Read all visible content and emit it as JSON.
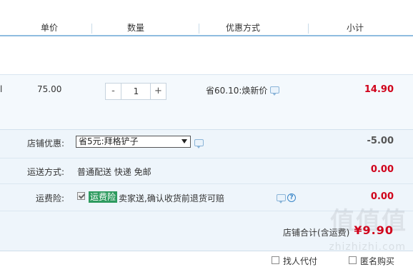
{
  "header": {
    "col_price": "单价",
    "col_quantity": "数量",
    "col_discount": "优惠方式",
    "col_subtotal": "小计"
  },
  "item": {
    "edge_text": "l",
    "unit_price": "75.00",
    "quantity": "1",
    "minus_label": "-",
    "plus_label": "+",
    "promotion": "省60.10:焕新价",
    "subtotal": "14.90"
  },
  "shop": {
    "discount_label": "店铺优惠:",
    "discount_selected": "省5元:拜格铲子",
    "discount_amount": "-5.00",
    "shipping_label": "运送方式:",
    "shipping_value": "普通配送 快递 免邮",
    "shipping_amount": "0.00",
    "insurance_label": "运费险:",
    "insurance_badge": "运费险",
    "insurance_text": "卖家送,确认收货前退货可赔",
    "insurance_help": "?",
    "insurance_amount": "0.00",
    "total_label": "店铺合计(含运费)",
    "total_amount": "¥9.90"
  },
  "footer": {
    "option_1": "找人代付",
    "option_2": "匿名购买"
  },
  "watermark": {
    "logo_text": "值值值",
    "site_text": "zhizhizhi.com"
  },
  "colors": {
    "accent_red": "#d0021b",
    "header_line": "#8fbce0",
    "panel_bg": "#eef5fb",
    "insurance_badge": "#2e9b5f"
  }
}
